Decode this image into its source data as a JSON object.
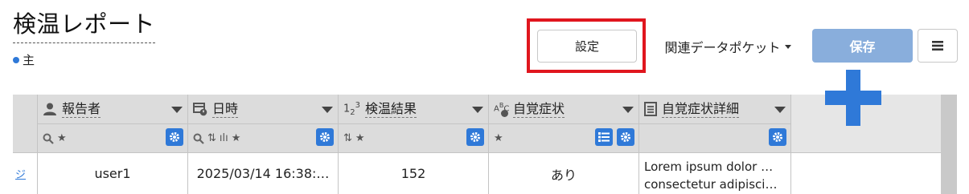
{
  "page": {
    "title": "検温レポート",
    "subtitle": "主"
  },
  "toolbar": {
    "settings_label": "設定",
    "pocket_label": "関連データポケット",
    "save_label": "保存"
  },
  "colors": {
    "accent": "#2f79d8",
    "save_bg": "#89aedc",
    "highlight": "#e0161e"
  },
  "table": {
    "columns": [
      {
        "label": "報告者",
        "icon": "person-icon",
        "filter_icons": "search-icon star-icon"
      },
      {
        "label": "日時",
        "icon": "calendar-clock-icon",
        "filter_icons": "search-icon sort-icon bars-icon star-icon"
      },
      {
        "label": "検温結果",
        "icon": "number-123-icon",
        "filter_icons": "sort-icon star-icon"
      },
      {
        "label": "自覚症状",
        "icon": "abc-check-icon",
        "filter_icons": "star-icon"
      },
      {
        "label": "自覚症状詳細",
        "icon": "document-icon",
        "filter_icons": ""
      }
    ],
    "rows": [
      {
        "lead": "ジ",
        "reporter": "user1",
        "datetime": "2025/03/14 16:38:…",
        "temperature": "152",
        "symptom": "あり",
        "detail_line1": "Lorem ipsum dolor …",
        "detail_line2": "consectetur adipisci…"
      }
    ]
  }
}
